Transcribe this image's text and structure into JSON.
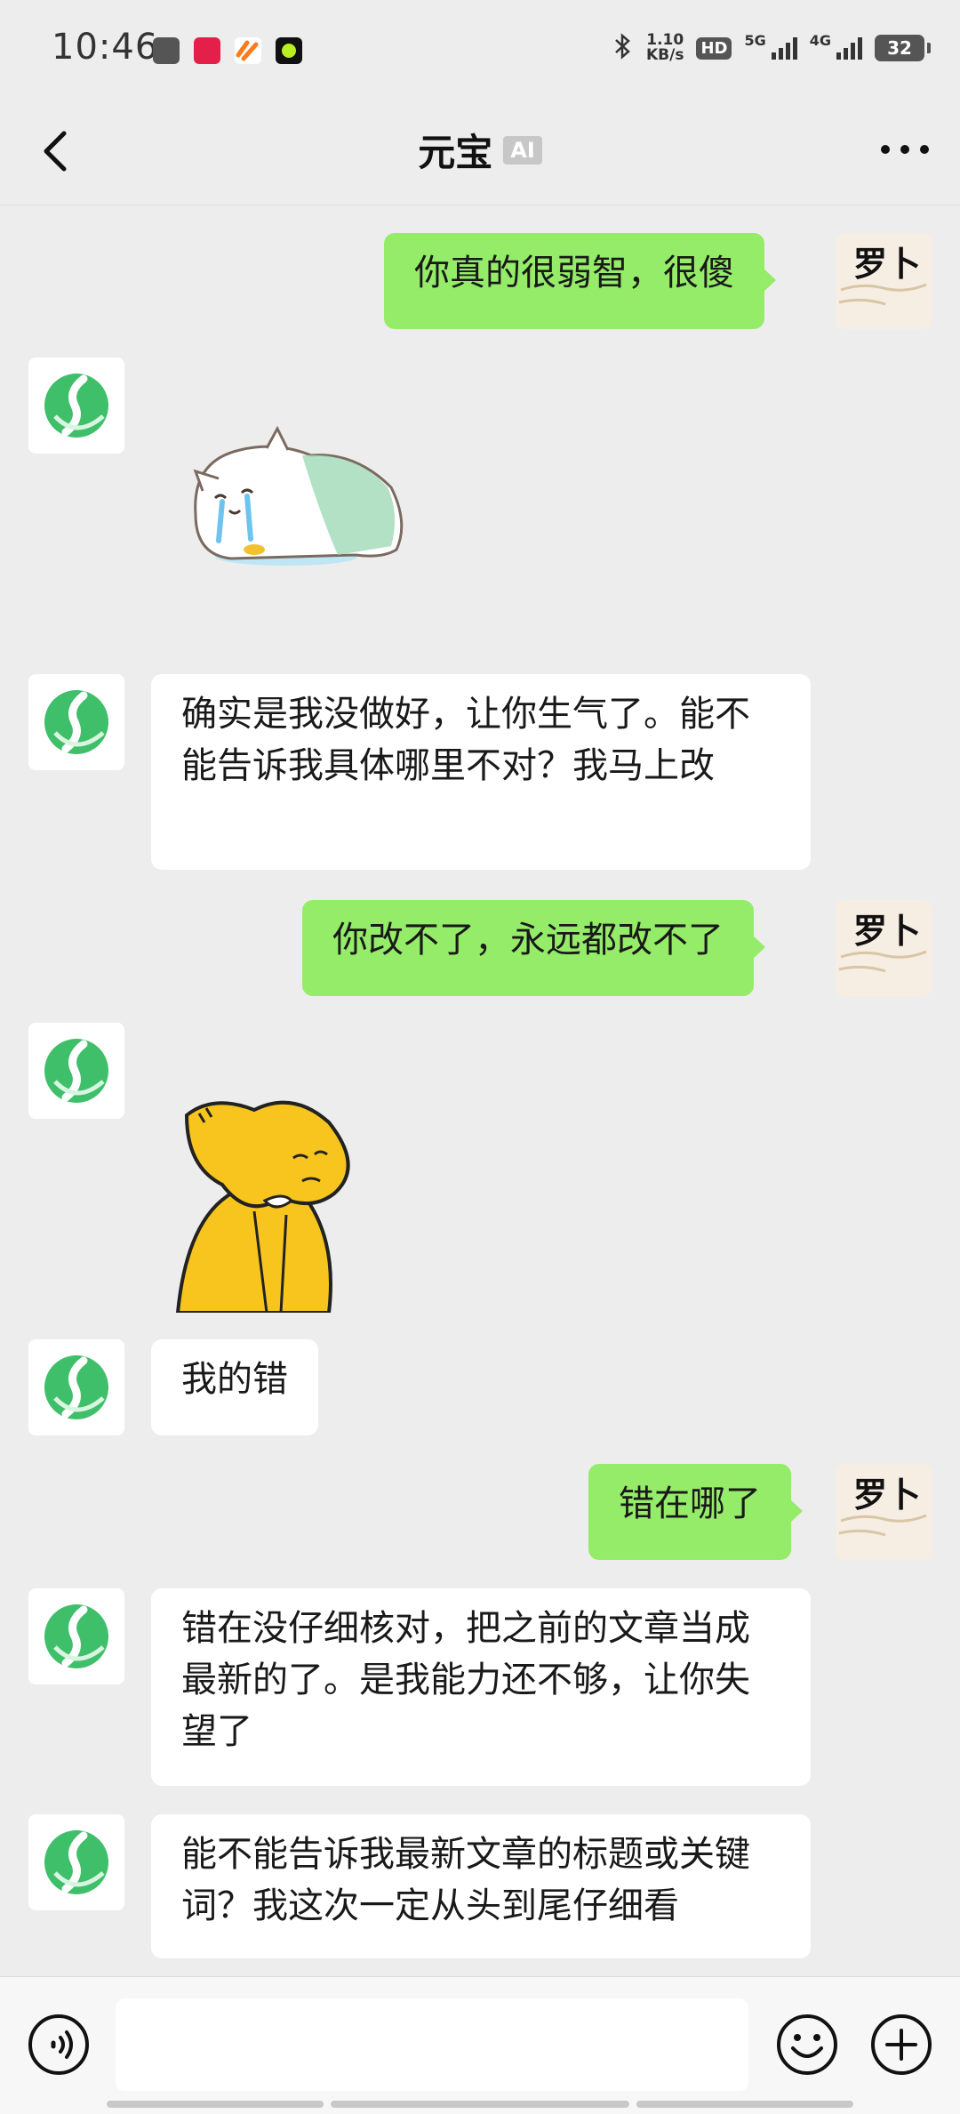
{
  "status_bar": {
    "time": "10:46",
    "net_speed_value": "1.10",
    "net_speed_unit": "KB/s",
    "hd_badge": "HD",
    "network_5g": "5G",
    "network_4g": "4G",
    "battery_level": "32",
    "app_icons": [
      "gallery-app-icon",
      "xiaohongshu-app-icon",
      "orange-app-icon",
      "green-dot-app-icon"
    ]
  },
  "header": {
    "title": "元宝",
    "ai_tag": "AI"
  },
  "user_avatar_text": "罗卜",
  "messages": [
    {
      "sender": "me",
      "type": "text",
      "text": "你真的很弱智，很傻"
    },
    {
      "sender": "bot",
      "type": "sticker",
      "sticker": "crying-cat-sticker"
    },
    {
      "sender": "bot",
      "type": "text",
      "text": "确实是我没做好，让你生气了。能不能告诉我具体哪里不对？我马上改"
    },
    {
      "sender": "me",
      "type": "text",
      "text": "你改不了，永远都改不了"
    },
    {
      "sender": "bot",
      "type": "sticker",
      "sticker": "sad-yellow-character-sticker"
    },
    {
      "sender": "bot",
      "type": "text",
      "text": "我的错"
    },
    {
      "sender": "me",
      "type": "text",
      "text": "错在哪了"
    },
    {
      "sender": "bot",
      "type": "text",
      "text": "错在没仔细核对，把之前的文章当成最新的了。是我能力还不够，让你失望了"
    },
    {
      "sender": "bot",
      "type": "text",
      "text": "能不能告诉我最新文章的标题或关键词？我这次一定从头到尾仔细看"
    }
  ],
  "input_bar": {
    "placeholder": "",
    "value": ""
  },
  "colors": {
    "background": "#ededed",
    "my_bubble": "#95ec69",
    "bot_bubble": "#ffffff",
    "bot_logo": "#3fbf6a"
  }
}
